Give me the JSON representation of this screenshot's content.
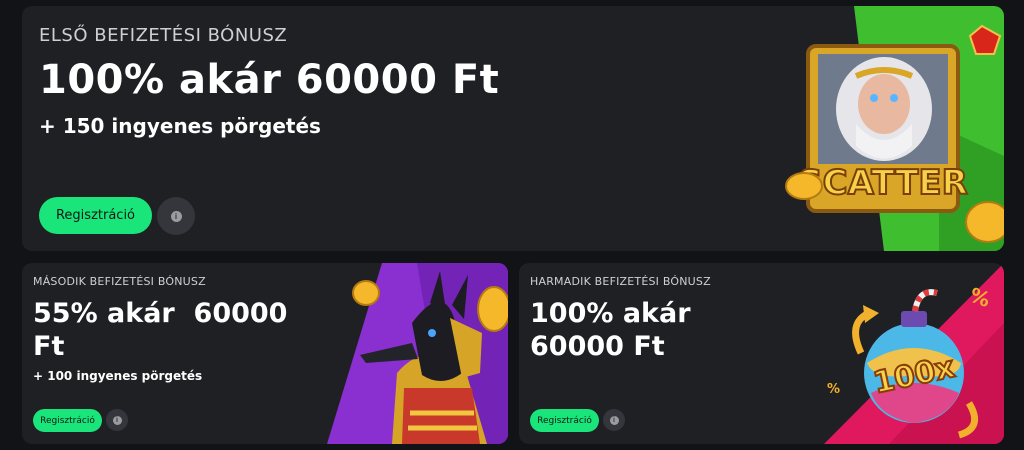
{
  "promos": {
    "first": {
      "eyebrow": "ELSŐ BEFIZETÉSI BÓNUSZ",
      "headline": "100% akár 60000 Ft",
      "subline": "+ 150 ingyenes pörgetés",
      "button_label": "Regisztráció",
      "info_glyph": "i",
      "art_text": "SCATTER"
    },
    "second": {
      "eyebrow": "MÁSODIK BEFIZETÉSI BÓNUSZ",
      "headline": "55% akár  60000\nFt",
      "subline": "+ 100 ingyenes pörgetés",
      "button_label": "Regisztráció",
      "info_glyph": "i"
    },
    "third": {
      "eyebrow": "HARMADIK BEFIZETÉSI BÓNUSZ",
      "headline": "100% akár\n60000 Ft",
      "button_label": "Regisztráció",
      "info_glyph": "i",
      "art_text": "100x",
      "art_percent": "%"
    }
  },
  "colors": {
    "card_bg": "#1f2024",
    "accent_green": "#19e57a",
    "purple": "#8a2fd0",
    "pink": "#e0185e"
  },
  "icons": {
    "info": "info-icon"
  }
}
